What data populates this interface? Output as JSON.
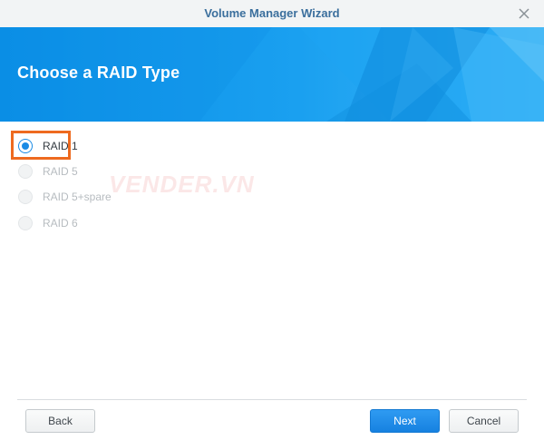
{
  "window": {
    "title": "Volume Manager Wizard",
    "close_icon": "close-icon"
  },
  "banner": {
    "title": "Choose a RAID Type",
    "color": "#1296eb"
  },
  "raid_options": [
    {
      "label": "RAID 1",
      "selected": true,
      "enabled": true
    },
    {
      "label": "RAID 5",
      "selected": false,
      "enabled": false
    },
    {
      "label": "RAID 5+spare",
      "selected": false,
      "enabled": false
    },
    {
      "label": "RAID 6",
      "selected": false,
      "enabled": false
    }
  ],
  "watermark": "VENDER.VN",
  "footer": {
    "back_label": "Back",
    "next_label": "Next",
    "cancel_label": "Cancel"
  },
  "colors": {
    "accent": "#1a8be5",
    "highlight": "#ee6a1f",
    "title_text": "#3b6f9d"
  }
}
